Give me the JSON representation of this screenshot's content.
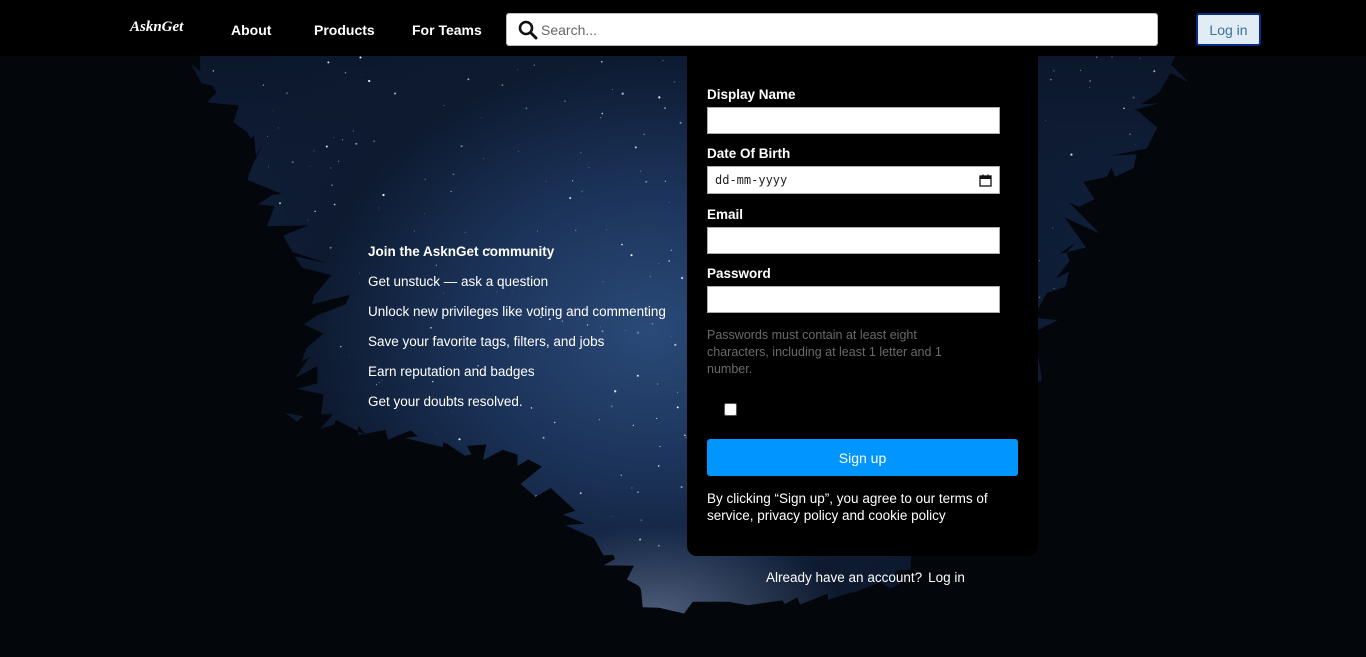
{
  "navbar": {
    "logo": "AsknGet",
    "links": [
      "About",
      "Products",
      "For Teams"
    ],
    "search": {
      "placeholder": "Search..."
    },
    "login_label": "Log in"
  },
  "community": {
    "heading": "Join the AsknGet community",
    "items": [
      "Get unstuck — ask a question",
      "Unlock new privileges like voting and commenting",
      "Save your favorite tags, filters, and jobs",
      "Earn reputation and badges",
      "Get your doubts resolved."
    ]
  },
  "form": {
    "display_name_label": "Display Name",
    "display_name_value": "",
    "dob_label": "Date Of Birth",
    "dob_placeholder": "dd-mm-yyyy",
    "email_label": "Email",
    "email_value": "",
    "password_label": "Password",
    "password_value": "",
    "password_hint": "Passwords must contain at least eight characters, including at least 1 letter and 1 number.",
    "signup_label": "Sign up",
    "terms": "By clicking “Sign up”, you agree to our terms of service, privacy policy and cookie policy"
  },
  "footer": {
    "already_text": "Already have an account?",
    "login_link": "Log in"
  },
  "icons": {
    "search": "search-icon",
    "calendar": "calendar-icon"
  },
  "colors": {
    "navbar_bg": "#000000",
    "card_bg": "#000000",
    "primary_button": "#0095ff",
    "login_button_bg": "#e1ecf4",
    "login_button_text": "#39739d"
  }
}
